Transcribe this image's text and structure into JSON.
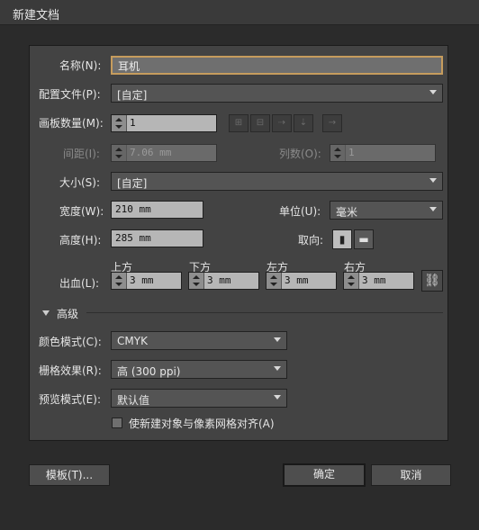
{
  "window": {
    "title": "新建文档"
  },
  "name": {
    "label": "名称(N):",
    "value": "耳机"
  },
  "profile": {
    "label": "配置文件(P):",
    "value": "[自定]"
  },
  "artboards": {
    "label": "画板数量(M):",
    "value": "1"
  },
  "spacing": {
    "label": "间距(I):",
    "value": "7.06 mm"
  },
  "columns": {
    "label": "列数(O):",
    "value": "1"
  },
  "size": {
    "label": "大小(S):",
    "value": "[自定]"
  },
  "width": {
    "label": "宽度(W):",
    "value": "210 mm"
  },
  "units": {
    "label": "单位(U):",
    "value": "毫米"
  },
  "height": {
    "label": "高度(H):",
    "value": "285 mm"
  },
  "orientation": {
    "label": "取向:"
  },
  "bleed": {
    "label": "出血(L):",
    "top_label": "上方",
    "top": "3 mm",
    "bottom_label": "下方",
    "bottom": "3 mm",
    "left_label": "左方",
    "left": "3 mm",
    "right_label": "右方",
    "right": "3 mm"
  },
  "advanced": {
    "label": "高级",
    "color_mode": {
      "label": "颜色模式(C):",
      "value": "CMYK"
    },
    "raster": {
      "label": "栅格效果(R):",
      "value": "高 (300 ppi)"
    },
    "preview": {
      "label": "预览模式(E):",
      "value": "默认值"
    },
    "align_pixel": {
      "label": "使新建对象与像素网格对齐(A)",
      "checked": false
    }
  },
  "buttons": {
    "templates": "模板(T)...",
    "ok": "确定",
    "cancel": "取消"
  },
  "colors": {
    "accent_focus": "#c69c5d",
    "panel": "#434343",
    "background": "#2b2b2b"
  }
}
